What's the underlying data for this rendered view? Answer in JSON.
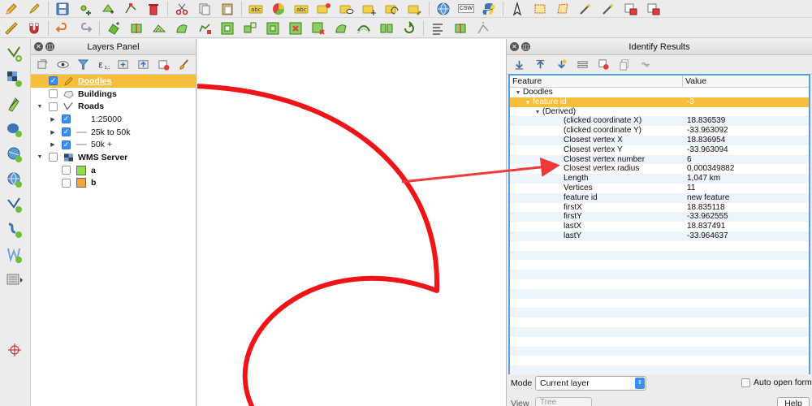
{
  "colors": {
    "accent_selected": "#f7be3c",
    "highlight_blue": "#5aa0dc",
    "doodle_red": "#f01418",
    "swatch_a": "#8ee04a",
    "swatch_b": "#f6a43a"
  },
  "toolbar_top": [
    "pencil-icon",
    "edit-icon",
    "save-icon",
    "add-point-icon",
    "move-feature-icon",
    "node-tool-icon",
    "delete-icon",
    "cut-icon",
    "copy-icon",
    "paste-icon",
    "label-abc-icon",
    "diagram-icon",
    "label-abc-icon",
    "pin-icon",
    "show-hide-icon",
    "label-move-icon",
    "label-rotate-icon",
    "label-change-icon",
    "globe-icon",
    "csw-label",
    "python-icon",
    "gps-icon",
    "select-rect-icon",
    "select-polygon-icon",
    "wand-icon",
    "wand-icon",
    "select-extra-icon",
    "select-extra-icon"
  ],
  "toolbar_top_csw": "CSW",
  "toolbar_second": [
    "ruler-icon",
    "magnet-icon",
    "undo-icon",
    "redo-icon",
    "merge-icon",
    "split-icon",
    "offset-icon",
    "reshape-icon",
    "simplify-icon",
    "add-ring-icon",
    "add-part-icon",
    "fill-ring-icon",
    "delete-ring-icon",
    "delete-part-icon",
    "reshape-icon",
    "offset-curve-icon",
    "split-parts-icon",
    "rotate-icon",
    "align-icon",
    "split-icon",
    "node-icon"
  ],
  "left_toolbar": [
    "add-vector-icon",
    "add-raster-icon",
    "add-delimited-icon",
    "add-postgis-icon",
    "add-spatialite-icon",
    "add-wms-icon",
    "add-wfs-icon",
    "add-virtual-icon",
    "add-line-icon",
    "add-gpx-icon",
    "crosshair-icon"
  ],
  "layers_panel": {
    "title": "Layers Panel",
    "layers": [
      {
        "name": "Doodles",
        "bold": true,
        "selected": true,
        "checked": true,
        "icon": "pencil-icon",
        "expander": "",
        "indent": 0
      },
      {
        "name": "Buildings",
        "bold": true,
        "selected": false,
        "checked": false,
        "icon": "polygon-icon",
        "expander": "",
        "indent": 0
      },
      {
        "name": "Roads",
        "bold": true,
        "selected": false,
        "checked": false,
        "icon": "line-icon",
        "expander": "▼",
        "indent": 0
      },
      {
        "name": "1:25000",
        "bold": false,
        "selected": false,
        "checked": true,
        "icon": "none",
        "expander": "▶",
        "indent": 1
      },
      {
        "name": "25k to 50k",
        "bold": false,
        "selected": false,
        "checked": true,
        "icon": "line-grey-icon",
        "expander": "▶",
        "indent": 1
      },
      {
        "name": "50k +",
        "bold": false,
        "selected": false,
        "checked": true,
        "icon": "line-grey-icon",
        "expander": "▶",
        "indent": 1
      },
      {
        "name": "WMS Server",
        "bold": true,
        "selected": false,
        "checked": false,
        "icon": "raster-icon",
        "expander": "▼",
        "indent": 0
      },
      {
        "name": "a",
        "bold": true,
        "selected": false,
        "checked": false,
        "icon": "swatch-a",
        "expander": "",
        "indent": 1
      },
      {
        "name": "b",
        "bold": true,
        "selected": false,
        "checked": false,
        "icon": "swatch-b",
        "expander": "",
        "indent": 1
      }
    ]
  },
  "identify_panel": {
    "title": "Identify Results",
    "columns": [
      "Feature",
      "Value"
    ],
    "rows": [
      {
        "feature": "Doodles",
        "value": "",
        "level": 0,
        "expander": "▼",
        "selected": false
      },
      {
        "feature": "feature id",
        "value": "-3",
        "level": 1,
        "expander": "▼",
        "selected": true
      },
      {
        "feature": "(Derived)",
        "value": "",
        "level": 2,
        "expander": "▼",
        "selected": false
      },
      {
        "feature": "(clicked coordinate X)",
        "value": "18.836539",
        "level": 3,
        "expander": "",
        "selected": false
      },
      {
        "feature": "(clicked coordinate Y)",
        "value": "-33.963092",
        "level": 3,
        "expander": "",
        "selected": false
      },
      {
        "feature": "Closest vertex X",
        "value": "18.836954",
        "level": 3,
        "expander": "",
        "selected": false
      },
      {
        "feature": "Closest vertex Y",
        "value": "-33.963094",
        "level": 3,
        "expander": "",
        "selected": false
      },
      {
        "feature": "Closest vertex number",
        "value": "6",
        "level": 3,
        "expander": "",
        "selected": false
      },
      {
        "feature": "Closest vertex radius",
        "value": "0,000349882",
        "level": 3,
        "expander": "",
        "selected": false
      },
      {
        "feature": "Length",
        "value": "1,047 km",
        "level": 3,
        "expander": "",
        "selected": false
      },
      {
        "feature": "Vertices",
        "value": "11",
        "level": 3,
        "expander": "",
        "selected": false
      },
      {
        "feature": "feature id",
        "value": "new feature",
        "level": 3,
        "expander": "",
        "selected": false
      },
      {
        "feature": "firstX",
        "value": "18.835118",
        "level": 3,
        "expander": "",
        "selected": false
      },
      {
        "feature": "firstY",
        "value": "-33.962555",
        "level": 3,
        "expander": "",
        "selected": false
      },
      {
        "feature": "lastX",
        "value": "18.837491",
        "level": 3,
        "expander": "",
        "selected": false
      },
      {
        "feature": "lastY",
        "value": "-33.964637",
        "level": 3,
        "expander": "",
        "selected": false
      }
    ],
    "mode_label": "Mode",
    "mode_value": "Current layer",
    "auto_open_label": "Auto open form",
    "view_label": "View",
    "view_value": "Tree",
    "help_label": "Help"
  }
}
